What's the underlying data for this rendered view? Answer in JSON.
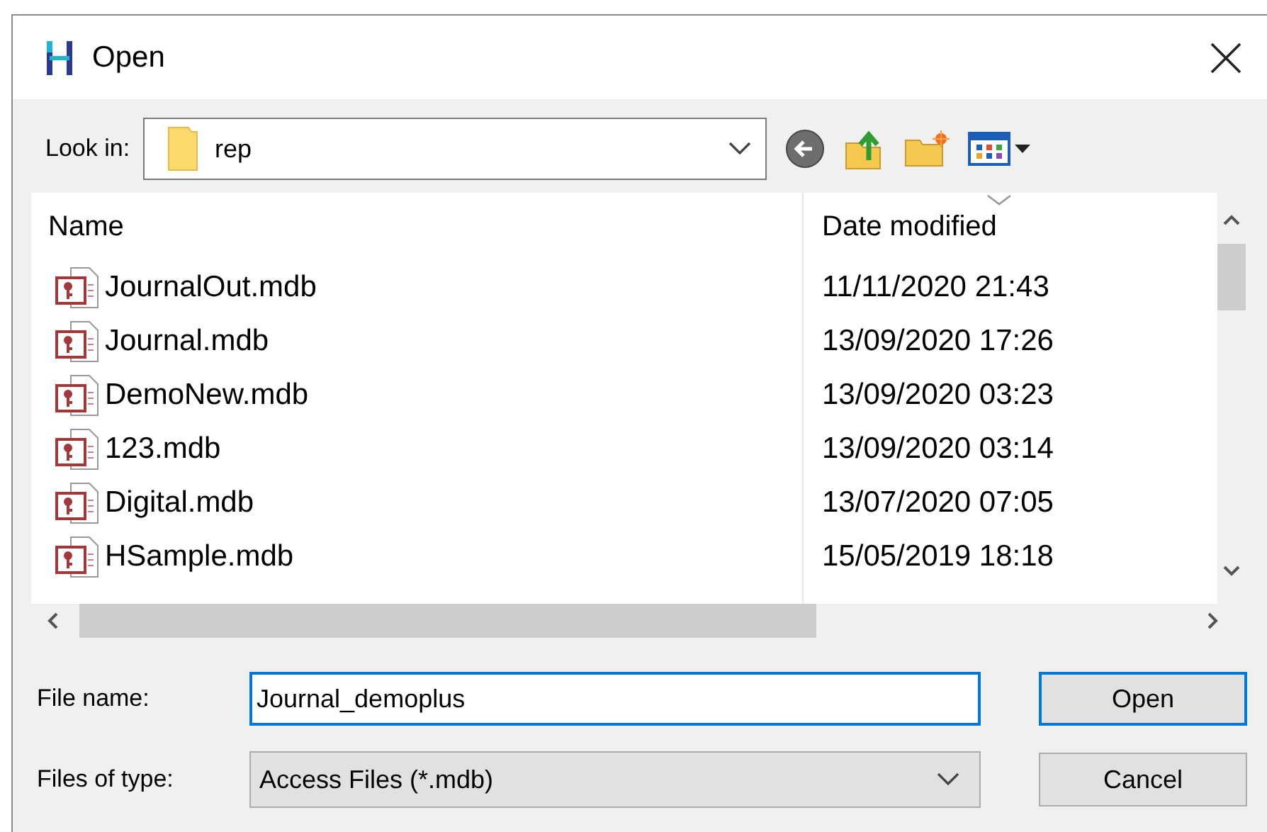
{
  "window": {
    "title": "Open"
  },
  "look_in": {
    "label": "Look in:",
    "value": "rep"
  },
  "columns": [
    {
      "label": "Name",
      "sorted": false
    },
    {
      "label": "Date modified",
      "sorted": true
    }
  ],
  "files": [
    {
      "name": "JournalOut.mdb",
      "date": "11/11/2020 21:43"
    },
    {
      "name": "Journal.mdb",
      "date": "13/09/2020 17:26"
    },
    {
      "name": "DemoNew.mdb",
      "date": "13/09/2020 03:23"
    },
    {
      "name": "123.mdb",
      "date": "13/09/2020 03:14"
    },
    {
      "name": "Digital.mdb",
      "date": "13/07/2020 07:05"
    },
    {
      "name": "HSample.mdb",
      "date": "15/05/2019 18:18"
    }
  ],
  "file_name": {
    "label": "File name:",
    "value": "Journal_demoplus"
  },
  "file_type": {
    "label": "Files of type:",
    "value": "Access Files (*.mdb)"
  },
  "buttons": [
    {
      "label": "Open",
      "default": true
    },
    {
      "label": "Cancel",
      "default": false
    }
  ]
}
